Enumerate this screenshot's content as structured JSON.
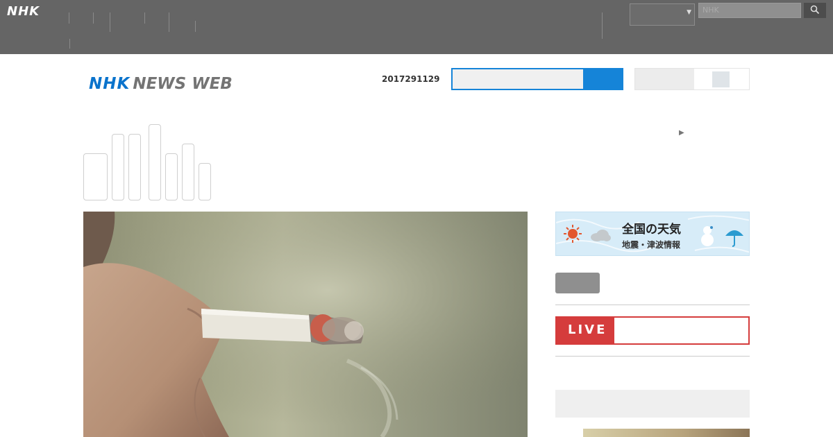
{
  "global_bar": {
    "logo": "NHK",
    "nav": [
      {
        "label": " \n \n "
      },
      {
        "label": " \n "
      },
      {
        "label": " "
      },
      {
        "label": " \n "
      },
      {
        "label": " \n "
      },
      {
        "label": " \n \n "
      }
    ],
    "right_nav": [
      {
        "label": " \n \n "
      },
      {
        "label": " \n "
      }
    ],
    "region_select": " ",
    "search_placeholder": "NHK",
    "search_icon": "search-icon",
    "colors": {
      "bar": "#656565",
      "search_button": "#4d4d4d"
    }
  },
  "header": {
    "logo_nhk": "NHK",
    "logo_newsweb": "NEWS WEB",
    "date": "2017291129",
    "search_value": "",
    "toggle_label": " ",
    "colors": {
      "accent": "#1584d8",
      "logo_blue": "#0a73cc"
    }
  },
  "categories": {
    "first_label": " \n \n \n ",
    "tabs": [
      {
        "label": ""
      },
      {
        "label": ""
      },
      {
        "label": ""
      },
      {
        "label": ""
      },
      {
        "label": ""
      },
      {
        "label": ""
      },
      {
        "label": ""
      }
    ],
    "right_link": " "
  },
  "sidebar": {
    "weather_title": "全国の天気",
    "weather_sub": "地震・津波情報",
    "button_text": " ",
    "live_badge": "LIVE",
    "live_text": " ",
    "ranking_heading": " ",
    "colors": {
      "live": "#d53c3c",
      "link": "#0f5f93",
      "weather_bg": "#d7ecf8"
    }
  }
}
